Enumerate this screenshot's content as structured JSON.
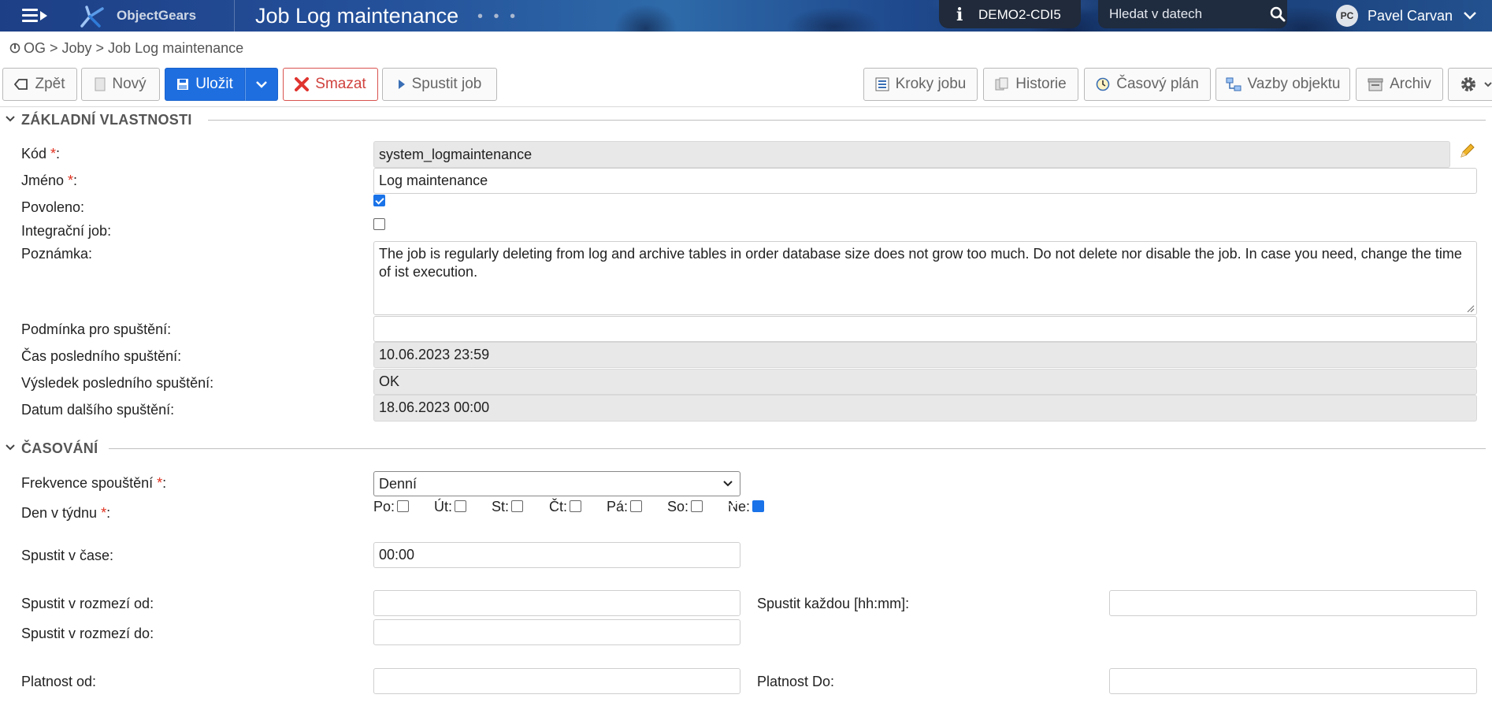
{
  "header": {
    "logo_text": "ObjectGears",
    "page_title": "Job Log maintenance",
    "dots": "• • •",
    "environment": "DEMO2-CDI5",
    "search_placeholder": "Hledat v datech",
    "user_initials": "PC",
    "user_name": "Pavel Carvan"
  },
  "breadcrumb": "OG > Joby > Job Log maintenance",
  "toolbar": {
    "back": "Zpět",
    "new": "Nový",
    "save": "Uložit",
    "delete": "Smazat",
    "run": "Spustit job",
    "steps": "Kroky jobu",
    "history": "Historie",
    "schedule": "Časový plán",
    "relations": "Vazby objektu",
    "archive": "Archiv"
  },
  "colors": {
    "primary": "#1e6ee0",
    "danger": "#d0423e",
    "required": "#e0301e"
  },
  "basic": {
    "title": "ZÁKLADNÍ VLASTNOSTI",
    "code_label": "Kód ",
    "code_value": "system_logmaintenance",
    "name_label": "Jméno ",
    "name_value": "Log maintenance",
    "enabled_label": "Povoleno:",
    "enabled": true,
    "integration_label": "Integrační job:",
    "integration": false,
    "note_label": "Poznámka:",
    "note_value": "The job is regularly deleting from log and archive tables in order database size does not grow too much. Do not delete nor disable the job. In case you need, change the time of ist execution.",
    "condition_label": "Podmínka pro spuštění:",
    "condition_value": "",
    "last_run_label": "Čas posledního spuštění:",
    "last_run_value": "10.06.2023 23:59",
    "last_result_label": "Výsledek posledního spuštění:",
    "last_result_value": "OK",
    "next_run_label": "Datum dalšího spuštění:",
    "next_run_value": "18.06.2023 00:00"
  },
  "timing": {
    "title": "ČASOVÁNÍ",
    "frequency_label": "Frekvence spouštění ",
    "frequency_value": "Denní",
    "weekday_label": "Den v týdnu ",
    "days": [
      {
        "label": "Po:",
        "checked": false
      },
      {
        "label": "Út:",
        "checked": false
      },
      {
        "label": "St:",
        "checked": false
      },
      {
        "label": "Čt:",
        "checked": false
      },
      {
        "label": "Pá:",
        "checked": false
      },
      {
        "label": "So:",
        "checked": false
      },
      {
        "label": "Ne:",
        "checked": true
      }
    ],
    "run_at_label": "Spustit v čase:",
    "run_at_value": "00:00",
    "range_from_label": "Spustit v rozmezí od:",
    "range_from_value": "",
    "every_label": "Spustit každou [hh:mm]:",
    "every_value": "",
    "range_to_label": "Spustit v rozmezí do:",
    "range_to_value": "",
    "valid_from_label": "Platnost od:",
    "valid_from_value": "",
    "valid_to_label": "Platnost Do:",
    "valid_to_value": ""
  }
}
